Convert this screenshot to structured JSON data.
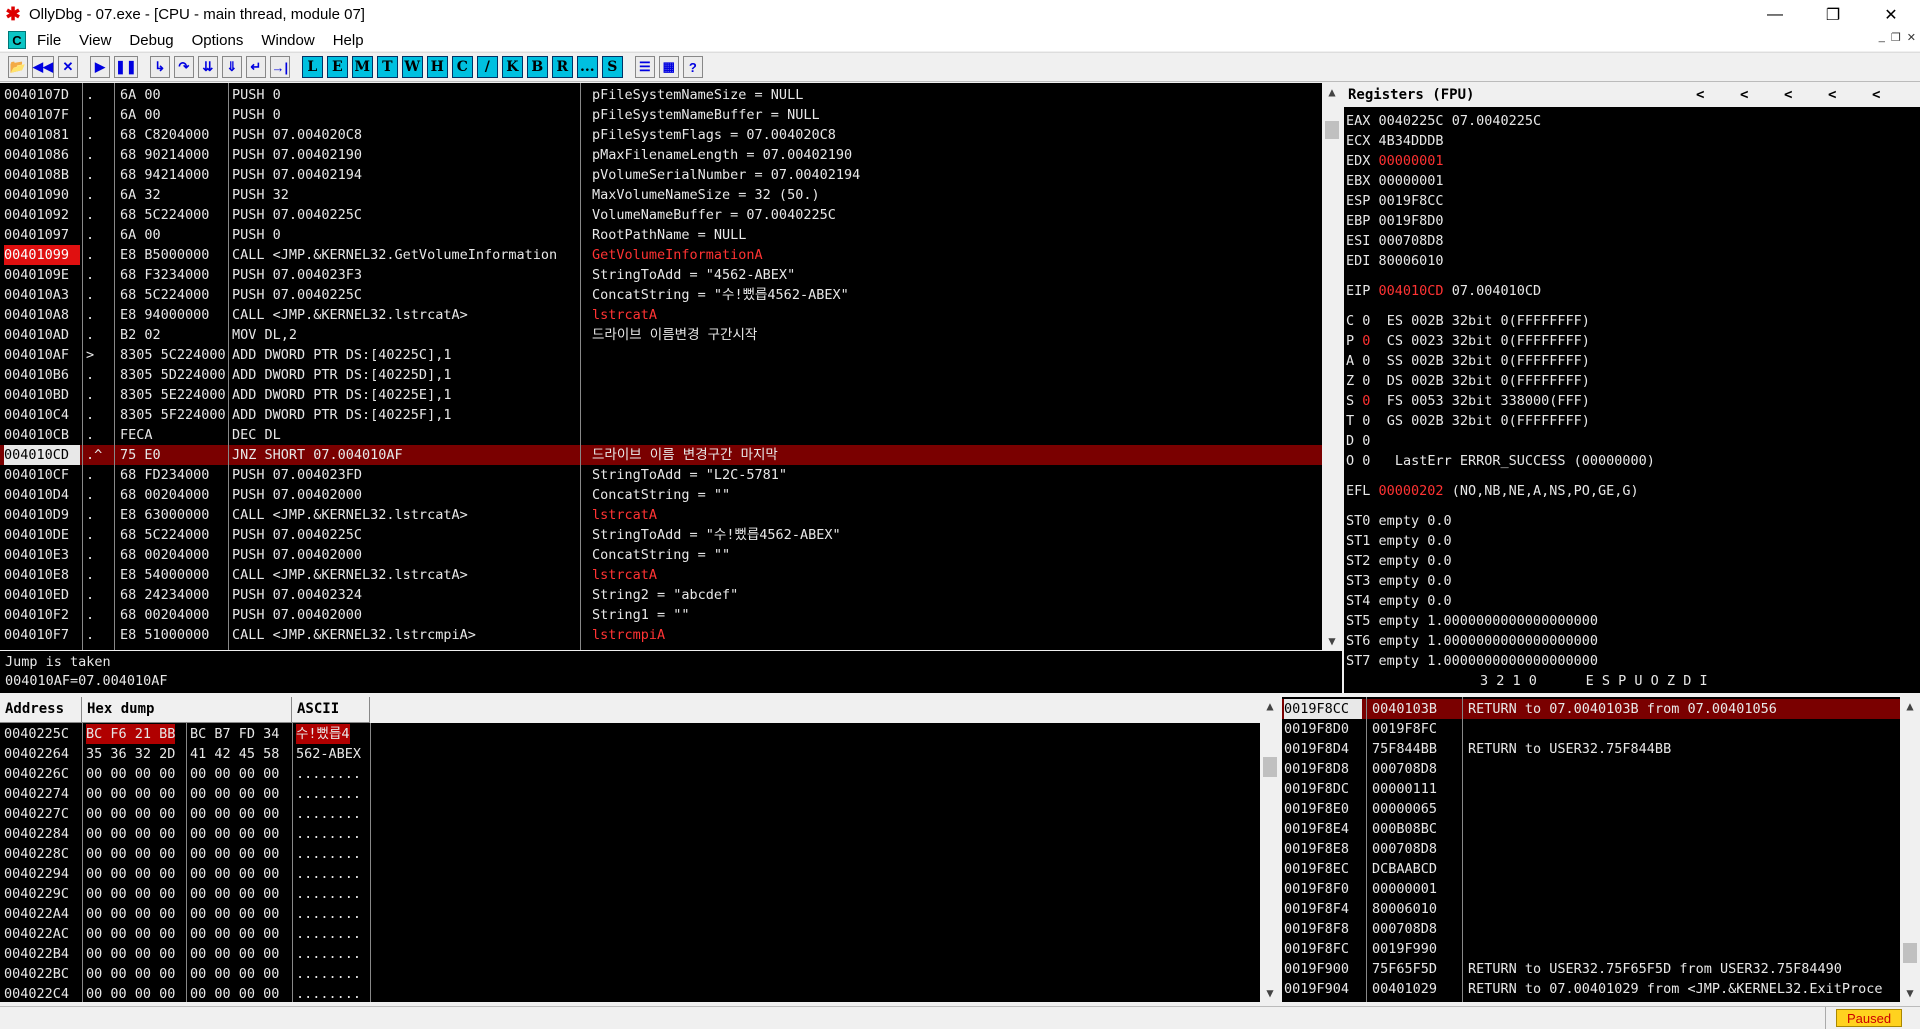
{
  "window": {
    "title": "OllyDbg - 07.exe - [CPU - main thread, module 07]",
    "minimize": "—",
    "restore": "❐",
    "close": "✕"
  },
  "menu": {
    "icon_label": "C",
    "items": [
      "File",
      "View",
      "Debug",
      "Options",
      "Window",
      "Help"
    ],
    "mdi_controls": [
      "_",
      "❐",
      "✕"
    ]
  },
  "toolbar": {
    "nav_buttons": [
      {
        "icon": "open-icon",
        "glyph": "📂"
      },
      {
        "icon": "rewind-icon",
        "glyph": "◀◀"
      },
      {
        "icon": "close-icon",
        "glyph": "✕"
      }
    ],
    "run_buttons": [
      {
        "icon": "run-icon",
        "glyph": "▶"
      },
      {
        "icon": "pause-icon",
        "glyph": "❚❚"
      }
    ],
    "step_buttons": [
      {
        "icon": "step-into-icon",
        "glyph": "↳"
      },
      {
        "icon": "step-over-icon",
        "glyph": "↷"
      },
      {
        "icon": "trace-into-icon",
        "glyph": "⇊"
      },
      {
        "icon": "trace-over-icon",
        "glyph": "⇓"
      },
      {
        "icon": "execute-till-return-icon",
        "glyph": "↵"
      },
      {
        "icon": "goto-icon",
        "glyph": "→|"
      }
    ],
    "window_buttons": [
      "L",
      "E",
      "M",
      "T",
      "W",
      "H",
      "C",
      "/",
      "K",
      "B",
      "R",
      "...",
      "S"
    ],
    "extra_buttons": [
      {
        "icon": "list-icon",
        "glyph": "☰"
      },
      {
        "icon": "grid-icon",
        "glyph": "▦"
      },
      {
        "icon": "help-icon",
        "glyph": "?"
      }
    ]
  },
  "disasm": [
    {
      "addr": "0040107D",
      "mark": ".",
      "hex": "6A 00",
      "cmd": "PUSH 0",
      "cmt": "pFileSystemNameSize = NULL"
    },
    {
      "addr": "0040107F",
      "mark": ".",
      "hex": "6A 00",
      "cmd": "PUSH 0",
      "cmt": "pFileSystemNameBuffer = NULL"
    },
    {
      "addr": "00401081",
      "mark": ".",
      "hex": "68 C8204000",
      "cmd": "PUSH 07.004020C8",
      "cmt": "pFileSystemFlags = 07.004020C8"
    },
    {
      "addr": "00401086",
      "mark": ".",
      "hex": "68 90214000",
      "cmd": "PUSH 07.00402190",
      "cmt": "pMaxFilenameLength = 07.00402190"
    },
    {
      "addr": "0040108B",
      "mark": ".",
      "hex": "68 94214000",
      "cmd": "PUSH 07.00402194",
      "cmt": "pVolumeSerialNumber = 07.00402194"
    },
    {
      "addr": "00401090",
      "mark": ".",
      "hex": "6A 32",
      "cmd": "PUSH 32",
      "cmt": "MaxVolumeNameSize = 32 (50.)"
    },
    {
      "addr": "00401092",
      "mark": ".",
      "hex": "68 5C224000",
      "cmd": "PUSH 07.0040225C",
      "cmt": "VolumeNameBuffer = 07.0040225C"
    },
    {
      "addr": "00401097",
      "mark": ".",
      "hex": "6A 00",
      "cmd": "PUSH 0",
      "cmt": "RootPathName = NULL"
    },
    {
      "addr": "00401099",
      "mark": ".",
      "hex": "E8 B5000000",
      "cmd": "CALL <JMP.&KERNEL32.GetVolumeInformation",
      "cmt": "GetVolumeInformationA"
    },
    {
      "addr": "0040109E",
      "mark": ".",
      "hex": "68 F3234000",
      "cmd": "PUSH 07.004023F3",
      "cmt": "StringToAdd = \"4562-ABEX\""
    },
    {
      "addr": "004010A3",
      "mark": ".",
      "hex": "68 5C224000",
      "cmd": "PUSH 07.0040225C",
      "cmt": "ConcatString = \"수!뻤릅4562-ABEX\""
    },
    {
      "addr": "004010A8",
      "mark": ".",
      "hex": "E8 94000000",
      "cmd": "CALL <JMP.&KERNEL32.lstrcatA>",
      "cmt": "lstrcatA"
    },
    {
      "addr": "004010AD",
      "mark": ".",
      "hex": "B2 02",
      "cmd": "MOV DL,2",
      "cmt": "드라이브 이름변경 구간시작"
    },
    {
      "addr": "004010AF",
      "mark": ">",
      "hex": "8305 5C224000",
      "cmd": "ADD DWORD PTR DS:[40225C],1",
      "cmt": ""
    },
    {
      "addr": "004010B6",
      "mark": ".",
      "hex": "8305 5D224000",
      "cmd": "ADD DWORD PTR DS:[40225D],1",
      "cmt": ""
    },
    {
      "addr": "004010BD",
      "mark": ".",
      "hex": "8305 5E224000",
      "cmd": "ADD DWORD PTR DS:[40225E],1",
      "cmt": ""
    },
    {
      "addr": "004010C4",
      "mark": ".",
      "hex": "8305 5F224000",
      "cmd": "ADD DWORD PTR DS:[40225F],1",
      "cmt": ""
    },
    {
      "addr": "004010CB",
      "mark": ".",
      "hex": "FECA",
      "cmd": "DEC DL",
      "cmt": ""
    },
    {
      "addr": "004010CD",
      "mark": ".^",
      "hex": "75 E0",
      "cmd": "JNZ SHORT 07.004010AF",
      "cmt": "드라이브 이름 변경구간 마지막"
    },
    {
      "addr": "004010CF",
      "mark": ".",
      "hex": "68 FD234000",
      "cmd": "PUSH 07.004023FD",
      "cmt": "StringToAdd = \"L2C-5781\""
    },
    {
      "addr": "004010D4",
      "mark": ".",
      "hex": "68 00204000",
      "cmd": "PUSH 07.00402000",
      "cmt": "ConcatString = \"\""
    },
    {
      "addr": "004010D9",
      "mark": ".",
      "hex": "E8 63000000",
      "cmd": "CALL <JMP.&KERNEL32.lstrcatA>",
      "cmt": "lstrcatA"
    },
    {
      "addr": "004010DE",
      "mark": ".",
      "hex": "68 5C224000",
      "cmd": "PUSH 07.0040225C",
      "cmt": "StringToAdd = \"수!뻤릅4562-ABEX\""
    },
    {
      "addr": "004010E3",
      "mark": ".",
      "hex": "68 00204000",
      "cmd": "PUSH 07.00402000",
      "cmt": "ConcatString = \"\""
    },
    {
      "addr": "004010E8",
      "mark": ".",
      "hex": "E8 54000000",
      "cmd": "CALL <JMP.&KERNEL32.lstrcatA>",
      "cmt": "lstrcatA"
    },
    {
      "addr": "004010ED",
      "mark": ".",
      "hex": "68 24234000",
      "cmd": "PUSH 07.00402324",
      "cmt": "String2 = \"abcdef\""
    },
    {
      "addr": "004010F2",
      "mark": ".",
      "hex": "68 00204000",
      "cmd": "PUSH 07.00402000",
      "cmt": "String1 = \"\""
    },
    {
      "addr": "004010F7",
      "mark": ".",
      "hex": "E8 51000000",
      "cmd": "CALL <JMP.&KERNEL32.lstrcmpiA>",
      "cmt": "lstrcmpiA"
    }
  ],
  "info": {
    "line1": "Jump is taken",
    "line2": "004010AF=07.004010AF"
  },
  "registers": {
    "header": "Registers (FPU)",
    "arrows": [
      "<",
      "<",
      "<",
      "<",
      "<"
    ],
    "rows": [
      {
        "name": "EAX",
        "value": "0040225C",
        "note": "07.0040225C"
      },
      {
        "name": "ECX",
        "value": "4B34DDDB",
        "note": ""
      },
      {
        "name": "EDX",
        "value": "00000001",
        "note": "",
        "changed": true
      },
      {
        "name": "EBX",
        "value": "00000001",
        "note": ""
      },
      {
        "name": "ESP",
        "value": "0019F8CC",
        "note": ""
      },
      {
        "name": "EBP",
        "value": "0019F8D0",
        "note": ""
      },
      {
        "name": "ESI",
        "value": "000708D8",
        "note": ""
      },
      {
        "name": "EDI",
        "value": "80006010",
        "note": ""
      }
    ],
    "eip": {
      "name": "EIP",
      "value": "004010CD",
      "note": "07.004010CD"
    },
    "flags": [
      {
        "flag": "C",
        "bit": "0",
        "seg": "ES 002B 32bit 0(FFFFFFFF)"
      },
      {
        "flag": "P",
        "bit": "0",
        "seg": "CS 0023 32bit 0(FFFFFFFF)",
        "changed": true
      },
      {
        "flag": "A",
        "bit": "0",
        "seg": "SS 002B 32bit 0(FFFFFFFF)"
      },
      {
        "flag": "Z",
        "bit": "0",
        "seg": "DS 002B 32bit 0(FFFFFFFF)"
      },
      {
        "flag": "S",
        "bit": "0",
        "seg": "FS 0053 32bit 338000(FFF)",
        "changed": true
      },
      {
        "flag": "T",
        "bit": "0",
        "seg": "GS 002B 32bit 0(FFFFFFFF)"
      },
      {
        "flag": "D",
        "bit": "0",
        "seg": ""
      },
      {
        "flag": "O",
        "bit": "0",
        "seg": " LastErr ERROR_SUCCESS (00000000)"
      }
    ],
    "efl": {
      "name": "EFL",
      "value": "00000202",
      "note": "(NO,NB,NE,A,NS,PO,GE,G)"
    },
    "fpu": [
      "ST0 empty 0.0",
      "ST1 empty 0.0",
      "ST2 empty 0.0",
      "ST3 empty 0.0",
      "ST4 empty 0.0",
      "ST5 empty 1.0000000000000000000",
      "ST6 empty 1.0000000000000000000",
      "ST7 empty 1.0000000000000000000"
    ],
    "fpu_footer": "3 2 1 0      E S P U O Z D I"
  },
  "dump": {
    "headers": [
      "Address",
      "Hex dump",
      "ASCII"
    ],
    "rows": [
      {
        "addr": "0040225C",
        "hex1": "BC F6 21 BB",
        "hex2": "BC B7 FD 34",
        "ascii": "수!뻤릅4",
        "hl": true
      },
      {
        "addr": "00402264",
        "hex1": "35 36 32 2D",
        "hex2": "41 42 45 58",
        "ascii": "562-ABEX"
      },
      {
        "addr": "0040226C",
        "hex1": "00 00 00 00",
        "hex2": "00 00 00 00",
        "ascii": "........"
      },
      {
        "addr": "00402274",
        "hex1": "00 00 00 00",
        "hex2": "00 00 00 00",
        "ascii": "........"
      },
      {
        "addr": "0040227C",
        "hex1": "00 00 00 00",
        "hex2": "00 00 00 00",
        "ascii": "........"
      },
      {
        "addr": "00402284",
        "hex1": "00 00 00 00",
        "hex2": "00 00 00 00",
        "ascii": "........"
      },
      {
        "addr": "0040228C",
        "hex1": "00 00 00 00",
        "hex2": "00 00 00 00",
        "ascii": "........"
      },
      {
        "addr": "00402294",
        "hex1": "00 00 00 00",
        "hex2": "00 00 00 00",
        "ascii": "........"
      },
      {
        "addr": "0040229C",
        "hex1": "00 00 00 00",
        "hex2": "00 00 00 00",
        "ascii": "........"
      },
      {
        "addr": "004022A4",
        "hex1": "00 00 00 00",
        "hex2": "00 00 00 00",
        "ascii": "........"
      },
      {
        "addr": "004022AC",
        "hex1": "00 00 00 00",
        "hex2": "00 00 00 00",
        "ascii": "........"
      },
      {
        "addr": "004022B4",
        "hex1": "00 00 00 00",
        "hex2": "00 00 00 00",
        "ascii": "........"
      },
      {
        "addr": "004022BC",
        "hex1": "00 00 00 00",
        "hex2": "00 00 00 00",
        "ascii": "........"
      },
      {
        "addr": "004022C4",
        "hex1": "00 00 00 00",
        "hex2": "00 00 00 00",
        "ascii": "........"
      }
    ]
  },
  "stack": [
    {
      "addr": "0019F8CC",
      "val": "0040103B",
      "cmt": "RETURN to 07.0040103B from 07.00401056",
      "hl": true
    },
    {
      "addr": "0019F8D0",
      "val": "0019F8FC",
      "cmt": ""
    },
    {
      "addr": "0019F8D4",
      "val": "75F844BB",
      "cmt": "RETURN to USER32.75F844BB"
    },
    {
      "addr": "0019F8D8",
      "val": "000708D8",
      "cmt": ""
    },
    {
      "addr": "0019F8DC",
      "val": "00000111",
      "cmt": ""
    },
    {
      "addr": "0019F8E0",
      "val": "00000065",
      "cmt": ""
    },
    {
      "addr": "0019F8E4",
      "val": "000B08BC",
      "cmt": ""
    },
    {
      "addr": "0019F8E8",
      "val": "000708D8",
      "cmt": ""
    },
    {
      "addr": "0019F8EC",
      "val": "DCBAABCD",
      "cmt": ""
    },
    {
      "addr": "0019F8F0",
      "val": "00000001",
      "cmt": ""
    },
    {
      "addr": "0019F8F4",
      "val": "80006010",
      "cmt": ""
    },
    {
      "addr": "0019F8F8",
      "val": "000708D8",
      "cmt": ""
    },
    {
      "addr": "0019F8FC",
      "val": "0019F990",
      "cmt": ""
    },
    {
      "addr": "0019F900",
      "val": "75F65F5D",
      "cmt": "RETURN to USER32.75F65F5D from USER32.75F84490"
    },
    {
      "addr": "0019F904",
      "val": "00401029",
      "cmt": "RETURN to 07.00401029 from <JMP.&KERNEL32.ExitProce"
    }
  ],
  "status": {
    "state": "Paused"
  },
  "colors": {
    "background": "#000000",
    "highlight_row": "#7a0000",
    "changed_value": "#ff3333",
    "status_paused": "#ffd21f"
  }
}
